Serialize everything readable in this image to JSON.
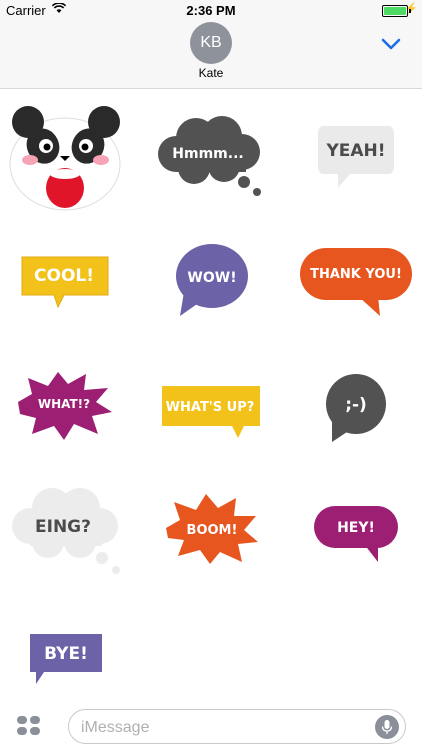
{
  "status_bar": {
    "carrier": "Carrier",
    "time": "2:36 PM"
  },
  "header": {
    "avatar_initials": "KB",
    "contact_name": "Kate"
  },
  "stickers": [
    {
      "id": "panda",
      "icon": "panda-face"
    },
    {
      "id": "hmmm",
      "text": "Hmmm..."
    },
    {
      "id": "yeah",
      "text": "YEAH!"
    },
    {
      "id": "cool",
      "text": "COOL!"
    },
    {
      "id": "wow",
      "text": "WOW!"
    },
    {
      "id": "thank-you",
      "text": "THANK YOU!"
    },
    {
      "id": "what",
      "text": "WHAT!?"
    },
    {
      "id": "whats-up",
      "text": "WHAT'S UP?"
    },
    {
      "id": "smiley",
      "text": ";-)"
    },
    {
      "id": "eing",
      "text": "EING?"
    },
    {
      "id": "boom",
      "text": "BOOM!"
    },
    {
      "id": "hey",
      "text": "HEY!"
    },
    {
      "id": "bye",
      "text": "BYE!"
    }
  ],
  "compose": {
    "placeholder": "iMessage"
  },
  "colors": {
    "accent_blue": "#1a6ee6",
    "gray_cloud": "#525252",
    "yellow": "#f3c21a",
    "purple": "#6b62a8",
    "orange": "#e85620",
    "magenta": "#9d1f73"
  }
}
